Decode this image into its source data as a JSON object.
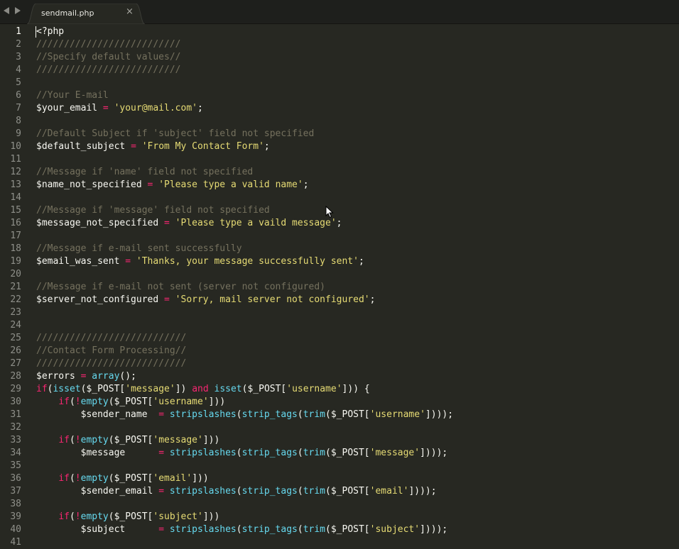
{
  "tab": {
    "title": "sendmail.php"
  },
  "editor": {
    "current_line": "1",
    "lines": [
      {
        "n": "1",
        "tokens": [
          {
            "t": "<?php",
            "k": "p"
          }
        ]
      },
      {
        "n": "2",
        "tokens": [
          {
            "t": "//////////////////////////",
            "k": "c"
          }
        ]
      },
      {
        "n": "3",
        "tokens": [
          {
            "t": "//Specify default values//",
            "k": "c"
          }
        ]
      },
      {
        "n": "4",
        "tokens": [
          {
            "t": "//////////////////////////",
            "k": "c"
          }
        ]
      },
      {
        "n": "5",
        "tokens": []
      },
      {
        "n": "6",
        "tokens": [
          {
            "t": "//Your E-mail",
            "k": "c"
          }
        ]
      },
      {
        "n": "7",
        "tokens": [
          {
            "t": "$your_email ",
            "k": "p"
          },
          {
            "t": "=",
            "k": "o"
          },
          {
            "t": " ",
            "k": "p"
          },
          {
            "t": "'your@mail.com'",
            "k": "s"
          },
          {
            "t": ";",
            "k": "p"
          }
        ]
      },
      {
        "n": "8",
        "tokens": []
      },
      {
        "n": "9",
        "tokens": [
          {
            "t": "//Default Subject if 'subject' field not specified",
            "k": "c"
          }
        ]
      },
      {
        "n": "10",
        "tokens": [
          {
            "t": "$default_subject ",
            "k": "p"
          },
          {
            "t": "=",
            "k": "o"
          },
          {
            "t": " ",
            "k": "p"
          },
          {
            "t": "'From My Contact Form'",
            "k": "s"
          },
          {
            "t": ";",
            "k": "p"
          }
        ]
      },
      {
        "n": "11",
        "tokens": []
      },
      {
        "n": "12",
        "tokens": [
          {
            "t": "//Message if 'name' field not specified",
            "k": "c"
          }
        ]
      },
      {
        "n": "13",
        "tokens": [
          {
            "t": "$name_not_specified ",
            "k": "p"
          },
          {
            "t": "=",
            "k": "o"
          },
          {
            "t": " ",
            "k": "p"
          },
          {
            "t": "'Please type a valid name'",
            "k": "s"
          },
          {
            "t": ";",
            "k": "p"
          }
        ]
      },
      {
        "n": "14",
        "tokens": []
      },
      {
        "n": "15",
        "tokens": [
          {
            "t": "//Message if 'message' field not specified",
            "k": "c"
          }
        ]
      },
      {
        "n": "16",
        "tokens": [
          {
            "t": "$message_not_specified ",
            "k": "p"
          },
          {
            "t": "=",
            "k": "o"
          },
          {
            "t": " ",
            "k": "p"
          },
          {
            "t": "'Please type a vaild message'",
            "k": "s"
          },
          {
            "t": ";",
            "k": "p"
          }
        ]
      },
      {
        "n": "17",
        "tokens": []
      },
      {
        "n": "18",
        "tokens": [
          {
            "t": "//Message if e-mail sent successfully",
            "k": "c"
          }
        ]
      },
      {
        "n": "19",
        "tokens": [
          {
            "t": "$email_was_sent ",
            "k": "p"
          },
          {
            "t": "=",
            "k": "o"
          },
          {
            "t": " ",
            "k": "p"
          },
          {
            "t": "'Thanks, your message successfully sent'",
            "k": "s"
          },
          {
            "t": ";",
            "k": "p"
          }
        ]
      },
      {
        "n": "20",
        "tokens": []
      },
      {
        "n": "21",
        "tokens": [
          {
            "t": "//Message if e-mail not sent (server not configured)",
            "k": "c"
          }
        ]
      },
      {
        "n": "22",
        "tokens": [
          {
            "t": "$server_not_configured ",
            "k": "p"
          },
          {
            "t": "=",
            "k": "o"
          },
          {
            "t": " ",
            "k": "p"
          },
          {
            "t": "'Sorry, mail server not configured'",
            "k": "s"
          },
          {
            "t": ";",
            "k": "p"
          }
        ]
      },
      {
        "n": "23",
        "tokens": []
      },
      {
        "n": "24",
        "tokens": []
      },
      {
        "n": "25",
        "tokens": [
          {
            "t": "///////////////////////////",
            "k": "c"
          }
        ]
      },
      {
        "n": "26",
        "tokens": [
          {
            "t": "//Contact Form Processing//",
            "k": "c"
          }
        ]
      },
      {
        "n": "27",
        "tokens": [
          {
            "t": "///////////////////////////",
            "k": "c"
          }
        ]
      },
      {
        "n": "28",
        "tokens": [
          {
            "t": "$errors ",
            "k": "p"
          },
          {
            "t": "=",
            "k": "o"
          },
          {
            "t": " ",
            "k": "p"
          },
          {
            "t": "array",
            "k": "f"
          },
          {
            "t": "();",
            "k": "p"
          }
        ]
      },
      {
        "n": "29",
        "tokens": [
          {
            "t": "if",
            "k": "k"
          },
          {
            "t": "(",
            "k": "p"
          },
          {
            "t": "isset",
            "k": "f"
          },
          {
            "t": "($_POST[",
            "k": "p"
          },
          {
            "t": "'message'",
            "k": "s"
          },
          {
            "t": "]) ",
            "k": "p"
          },
          {
            "t": "and",
            "k": "k"
          },
          {
            "t": " ",
            "k": "p"
          },
          {
            "t": "isset",
            "k": "f"
          },
          {
            "t": "($_POST[",
            "k": "p"
          },
          {
            "t": "'username'",
            "k": "s"
          },
          {
            "t": "])) {",
            "k": "p"
          }
        ]
      },
      {
        "n": "30",
        "tokens": [
          {
            "t": "    ",
            "k": "p"
          },
          {
            "t": "if",
            "k": "k"
          },
          {
            "t": "(",
            "k": "p"
          },
          {
            "t": "!",
            "k": "o"
          },
          {
            "t": "empty",
            "k": "f"
          },
          {
            "t": "($_POST[",
            "k": "p"
          },
          {
            "t": "'username'",
            "k": "s"
          },
          {
            "t": "]))",
            "k": "p"
          }
        ]
      },
      {
        "n": "31",
        "tokens": [
          {
            "t": "        $sender_name  ",
            "k": "p"
          },
          {
            "t": "=",
            "k": "o"
          },
          {
            "t": " ",
            "k": "p"
          },
          {
            "t": "stripslashes",
            "k": "f"
          },
          {
            "t": "(",
            "k": "p"
          },
          {
            "t": "strip_tags",
            "k": "f"
          },
          {
            "t": "(",
            "k": "p"
          },
          {
            "t": "trim",
            "k": "f"
          },
          {
            "t": "($_POST[",
            "k": "p"
          },
          {
            "t": "'username'",
            "k": "s"
          },
          {
            "t": "])));",
            "k": "p"
          }
        ]
      },
      {
        "n": "32",
        "tokens": []
      },
      {
        "n": "33",
        "tokens": [
          {
            "t": "    ",
            "k": "p"
          },
          {
            "t": "if",
            "k": "k"
          },
          {
            "t": "(",
            "k": "p"
          },
          {
            "t": "!",
            "k": "o"
          },
          {
            "t": "empty",
            "k": "f"
          },
          {
            "t": "($_POST[",
            "k": "p"
          },
          {
            "t": "'message'",
            "k": "s"
          },
          {
            "t": "]))",
            "k": "p"
          }
        ]
      },
      {
        "n": "34",
        "tokens": [
          {
            "t": "        $message      ",
            "k": "p"
          },
          {
            "t": "=",
            "k": "o"
          },
          {
            "t": " ",
            "k": "p"
          },
          {
            "t": "stripslashes",
            "k": "f"
          },
          {
            "t": "(",
            "k": "p"
          },
          {
            "t": "strip_tags",
            "k": "f"
          },
          {
            "t": "(",
            "k": "p"
          },
          {
            "t": "trim",
            "k": "f"
          },
          {
            "t": "($_POST[",
            "k": "p"
          },
          {
            "t": "'message'",
            "k": "s"
          },
          {
            "t": "])));",
            "k": "p"
          }
        ]
      },
      {
        "n": "35",
        "tokens": []
      },
      {
        "n": "36",
        "tokens": [
          {
            "t": "    ",
            "k": "p"
          },
          {
            "t": "if",
            "k": "k"
          },
          {
            "t": "(",
            "k": "p"
          },
          {
            "t": "!",
            "k": "o"
          },
          {
            "t": "empty",
            "k": "f"
          },
          {
            "t": "($_POST[",
            "k": "p"
          },
          {
            "t": "'email'",
            "k": "s"
          },
          {
            "t": "]))",
            "k": "p"
          }
        ]
      },
      {
        "n": "37",
        "tokens": [
          {
            "t": "        $sender_email ",
            "k": "p"
          },
          {
            "t": "=",
            "k": "o"
          },
          {
            "t": " ",
            "k": "p"
          },
          {
            "t": "stripslashes",
            "k": "f"
          },
          {
            "t": "(",
            "k": "p"
          },
          {
            "t": "strip_tags",
            "k": "f"
          },
          {
            "t": "(",
            "k": "p"
          },
          {
            "t": "trim",
            "k": "f"
          },
          {
            "t": "($_POST[",
            "k": "p"
          },
          {
            "t": "'email'",
            "k": "s"
          },
          {
            "t": "])));",
            "k": "p"
          }
        ]
      },
      {
        "n": "38",
        "tokens": []
      },
      {
        "n": "39",
        "tokens": [
          {
            "t": "    ",
            "k": "p"
          },
          {
            "t": "if",
            "k": "k"
          },
          {
            "t": "(",
            "k": "p"
          },
          {
            "t": "!",
            "k": "o"
          },
          {
            "t": "empty",
            "k": "f"
          },
          {
            "t": "($_POST[",
            "k": "p"
          },
          {
            "t": "'subject'",
            "k": "s"
          },
          {
            "t": "]))",
            "k": "p"
          }
        ]
      },
      {
        "n": "40",
        "tokens": [
          {
            "t": "        $subject      ",
            "k": "p"
          },
          {
            "t": "=",
            "k": "o"
          },
          {
            "t": " ",
            "k": "p"
          },
          {
            "t": "stripslashes",
            "k": "f"
          },
          {
            "t": "(",
            "k": "p"
          },
          {
            "t": "strip_tags",
            "k": "f"
          },
          {
            "t": "(",
            "k": "p"
          },
          {
            "t": "trim",
            "k": "f"
          },
          {
            "t": "($_POST[",
            "k": "p"
          },
          {
            "t": "'subject'",
            "k": "s"
          },
          {
            "t": "])));",
            "k": "p"
          }
        ]
      },
      {
        "n": "41",
        "tokens": []
      }
    ]
  },
  "colors": {
    "background": "#272822",
    "comment": "#75715e",
    "string": "#e6db74",
    "operator": "#f92672",
    "function": "#66d9ef",
    "plain": "#f8f8f2"
  },
  "icons": {
    "nav_back": "chevron-left-icon",
    "nav_forward": "chevron-right-icon",
    "close": "close-icon",
    "pointer": "mouse-pointer-icon"
  }
}
